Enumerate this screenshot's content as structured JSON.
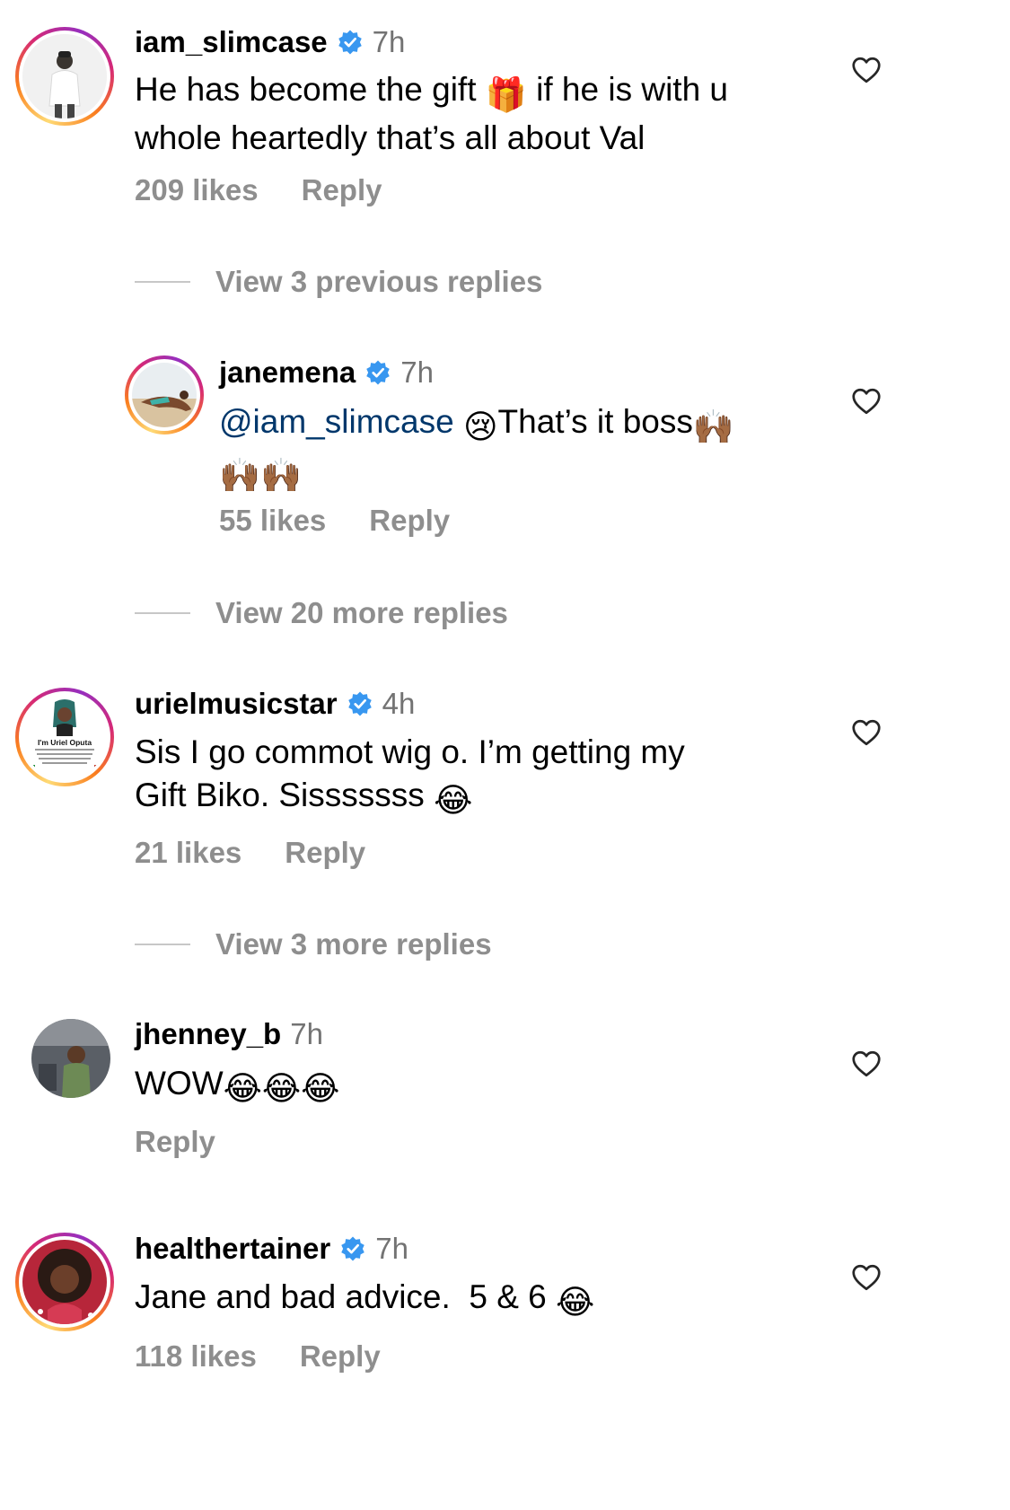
{
  "comments": [
    {
      "username": "iam_slimcase",
      "time": "7h",
      "text_before": "He has become the gift ",
      "emoji1": "🎁",
      "text_after": " if he is with u\nwhole heartedly that’s all about Val",
      "likes": "209 likes",
      "reply": "Reply"
    },
    {
      "username": "janemena",
      "time": "7h",
      "mention": "@iam_slimcase",
      "emoji1": "😢",
      "text": "That’s it boss",
      "emoji2": "🙌🏾",
      "emoji3": "🙌🏾🙌🏾",
      "likes": "55 likes",
      "reply": "Reply"
    },
    {
      "username": "urielmusicstar",
      "time": "4h",
      "text": "Sis I go commot wig o. I’m getting my\nGift Biko. Sisssssss ",
      "emoji1": "😂",
      "likes": "21 likes",
      "reply": "Reply",
      "avatar_text": "I'm Uriel Oputa"
    },
    {
      "username": "jhenney_b",
      "time": "7h",
      "text": "WOW",
      "emoji1": "😂😂😂",
      "reply": "Reply"
    },
    {
      "username": "healthertainer",
      "time": "7h",
      "text": "Jane and bad advice.  5 & 6 ",
      "emoji1": "😂",
      "likes": "118 likes",
      "reply": "Reply"
    }
  ],
  "view_replies": [
    "View 3 previous replies",
    "View 20 more replies",
    "View 3 more replies"
  ],
  "colors": {
    "verified": "#3897f0",
    "meta": "#8e8e8e",
    "mention": "#00376b"
  },
  "icons": {
    "verified": "verified-badge-icon",
    "heart": "heart-outline-icon"
  }
}
